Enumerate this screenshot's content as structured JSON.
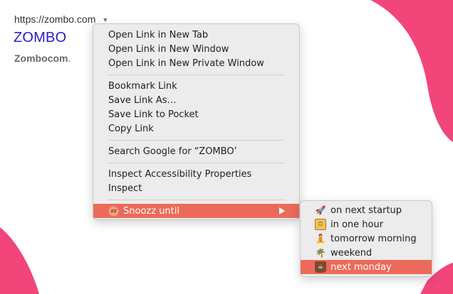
{
  "page": {
    "url": "https://zombo.com",
    "title": "ZOMBO",
    "desc_bold": "Zombocom",
    "desc_tail": "."
  },
  "colors": {
    "accent_pink": "#f2457a",
    "highlight": "#ec6a5a",
    "link": "#2a1cc4"
  },
  "context_menu": {
    "items": [
      {
        "label": "Open Link in New Tab"
      },
      {
        "label": "Open Link in New Window"
      },
      {
        "label": "Open Link in New Private Window"
      },
      {
        "label": "Bookmark Link"
      },
      {
        "label": "Save Link As…"
      },
      {
        "label": "Save Link to Pocket"
      },
      {
        "label": "Copy Link"
      },
      {
        "label": "Search Google for “ZOMBO’"
      },
      {
        "label": "Inspect Accessibility Properties"
      },
      {
        "label": "Inspect"
      }
    ],
    "snooze": {
      "label": "Snoozz until",
      "icon": "snoozz-icon",
      "icon_text": "zz"
    }
  },
  "submenu": {
    "items": [
      {
        "label": "on next startup",
        "icon": "rocket-icon"
      },
      {
        "label": "in one hour",
        "icon": "clock-icon"
      },
      {
        "label": "tomorrow morning",
        "icon": "meditation-icon"
      },
      {
        "label": "weekend",
        "icon": "palm-tree-icon"
      },
      {
        "label": "next monday",
        "icon": "coffee-cup-icon"
      }
    ]
  }
}
